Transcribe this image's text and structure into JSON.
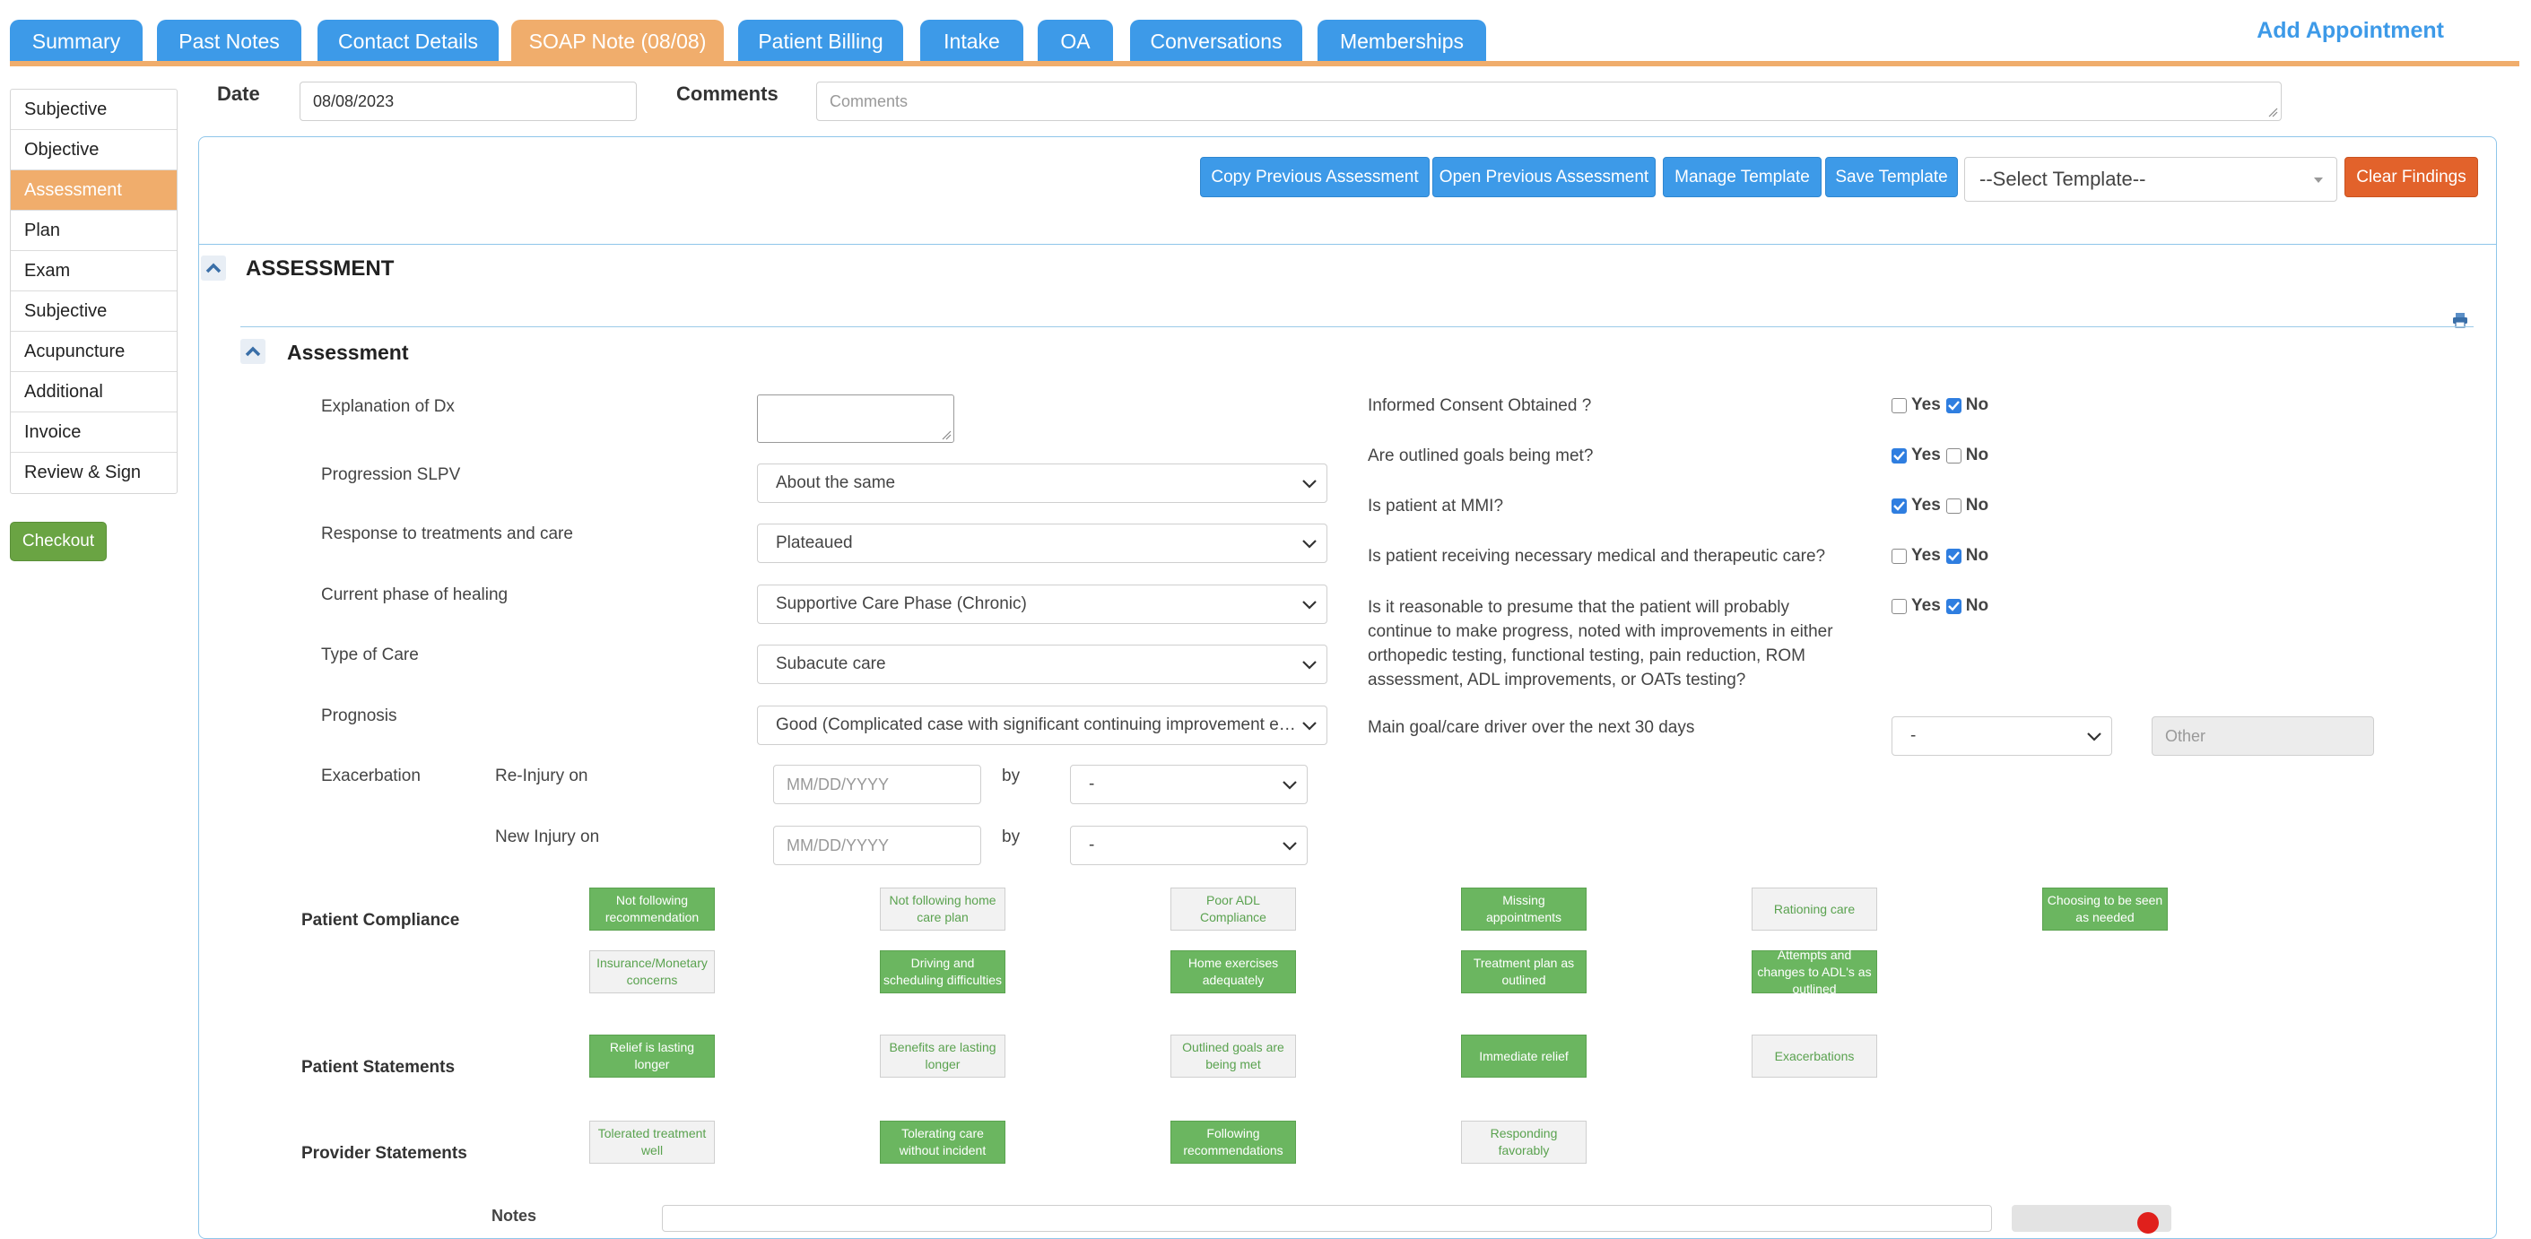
{
  "tabs": [
    {
      "label": "Summary"
    },
    {
      "label": "Past Notes"
    },
    {
      "label": "Contact Details"
    },
    {
      "label": "SOAP Note (08/08)"
    },
    {
      "label": "Patient Billing"
    },
    {
      "label": "Intake"
    },
    {
      "label": "OA"
    },
    {
      "label": "Conversations"
    },
    {
      "label": "Memberships"
    }
  ],
  "active_tab": "SOAP Note (08/08)",
  "add_appointment": "Add Appointment",
  "sidebar": {
    "items": [
      {
        "label": "Subjective"
      },
      {
        "label": "Objective"
      },
      {
        "label": "Assessment"
      },
      {
        "label": "Plan"
      },
      {
        "label": "Exam"
      },
      {
        "label": "Subjective"
      },
      {
        "label": "Acupuncture"
      },
      {
        "label": "Additional"
      },
      {
        "label": "Invoice"
      },
      {
        "label": "Review & Sign"
      }
    ],
    "active": "Assessment",
    "checkout": "Checkout"
  },
  "header": {
    "date_label": "Date",
    "date_value": "08/08/2023",
    "comments_label": "Comments",
    "comments_placeholder": "Comments"
  },
  "toolbar": {
    "copy_prev": "Copy Previous Assessment",
    "open_prev": "Open Previous Assessment",
    "manage_template": "Manage Template",
    "save_template": "Save Template",
    "select_template": "--Select Template--",
    "clear_findings": "Clear Findings"
  },
  "section": {
    "title": "ASSESSMENT",
    "sub_title": "Assessment"
  },
  "form": {
    "explanation_label": "Explanation of Dx",
    "progression_label": "Progression SLPV",
    "progression_value": "About the same",
    "response_label": "Response to treatments and care",
    "response_value": "Plateaued",
    "phase_label": "Current phase of healing",
    "phase_value": "Supportive Care Phase (Chronic)",
    "type_label": "Type of Care",
    "type_value": "Subacute care",
    "prognosis_label": "Prognosis",
    "prognosis_value": "Good (Complicated case with significant continuing improvement expe",
    "exacerbation_label": "Exacerbation",
    "reinjury_label": "Re-Injury on",
    "reinjury_placeholder": "MM/DD/YYYY",
    "reinjury_by_label": "by",
    "reinjury_by_value": "-",
    "newinjury_label": "New Injury on",
    "newinjury_placeholder": "MM/DD/YYYY",
    "newinjury_by_label": "by",
    "newinjury_by_value": "-"
  },
  "questions": [
    {
      "text": "Informed Consent Obtained ?",
      "yes": false,
      "no": true
    },
    {
      "text": "Are outlined goals being met?",
      "yes": true,
      "no": false
    },
    {
      "text": "Is patient at MMI?",
      "yes": true,
      "no": false
    },
    {
      "text": "Is patient receiving necessary medical and therapeutic care?",
      "yes": false,
      "no": true
    },
    {
      "text": "Is it reasonable to presume that the patient will probably continue to make progress, noted with improvements in either orthopedic testing, functional testing, pain reduction, ROM assessment, ADL improvements, or OATs testing?",
      "yes": false,
      "no": true
    }
  ],
  "yes_label": "Yes",
  "no_label": "No",
  "main_goal": {
    "label": "Main goal/care driver over the next 30 days",
    "value": "-",
    "other_placeholder": "Other"
  },
  "patient_compliance": {
    "label": "Patient Compliance",
    "chips": [
      {
        "text": "Not following recommendation",
        "on": true
      },
      {
        "text": "Not following home care plan",
        "on": false
      },
      {
        "text": "Poor ADL Compliance",
        "on": false
      },
      {
        "text": "Missing appointments",
        "on": true
      },
      {
        "text": "Rationing care",
        "on": false
      },
      {
        "text": "Choosing to be seen as needed",
        "on": true
      },
      {
        "text": "Insurance/Monetary concerns",
        "on": false
      },
      {
        "text": "Driving and scheduling difficulties",
        "on": true
      },
      {
        "text": "Home exercises adequately",
        "on": true
      },
      {
        "text": "Treatment plan as outlined",
        "on": true
      },
      {
        "text": "Attempts and changes to ADL's as outlined",
        "on": true
      }
    ]
  },
  "patient_statements": {
    "label": "Patient Statements",
    "chips": [
      {
        "text": "Relief is lasting longer",
        "on": true
      },
      {
        "text": "Benefits are lasting longer",
        "on": false
      },
      {
        "text": "Outlined goals are being met",
        "on": false
      },
      {
        "text": "Immediate relief",
        "on": true
      },
      {
        "text": "Exacerbations",
        "on": false
      }
    ]
  },
  "provider_statements": {
    "label": "Provider Statements",
    "chips": [
      {
        "text": "Tolerated treatment well",
        "on": false
      },
      {
        "text": "Tolerating care without incident",
        "on": true
      },
      {
        "text": "Following recommendations",
        "on": true
      },
      {
        "text": "Responding favorably",
        "on": false
      }
    ]
  },
  "notes_label": "Notes",
  "colors": {
    "tab_blue": "#3d9ae8",
    "tab_active": "#f0ad6c",
    "chip_on": "#6bb660",
    "clear_findings": "#e2622b",
    "checkout": "#6aa443"
  }
}
